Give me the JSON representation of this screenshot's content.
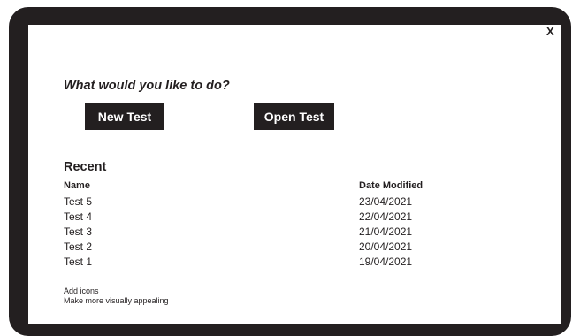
{
  "window": {
    "close_label": "X"
  },
  "prompt": "What would you like to do?",
  "actions": {
    "new_test": "New Test",
    "open_test": "Open Test"
  },
  "recent": {
    "title": "Recent",
    "columns": {
      "name": "Name",
      "date": "Date Modified"
    },
    "rows": [
      {
        "name": "Test 5",
        "date": "23/04/2021"
      },
      {
        "name": "Test 4",
        "date": "22/04/2021"
      },
      {
        "name": "Test 3",
        "date": "21/04/2021"
      },
      {
        "name": "Test 2",
        "date": "20/04/2021"
      },
      {
        "name": "Test 1",
        "date": "19/04/2021"
      }
    ]
  },
  "notes": [
    "Add icons",
    "Make more visually appealing"
  ],
  "colors": {
    "frame": "#231f20",
    "screen": "#ffffff",
    "button": "#231f20",
    "button_text": "#ffffff"
  }
}
